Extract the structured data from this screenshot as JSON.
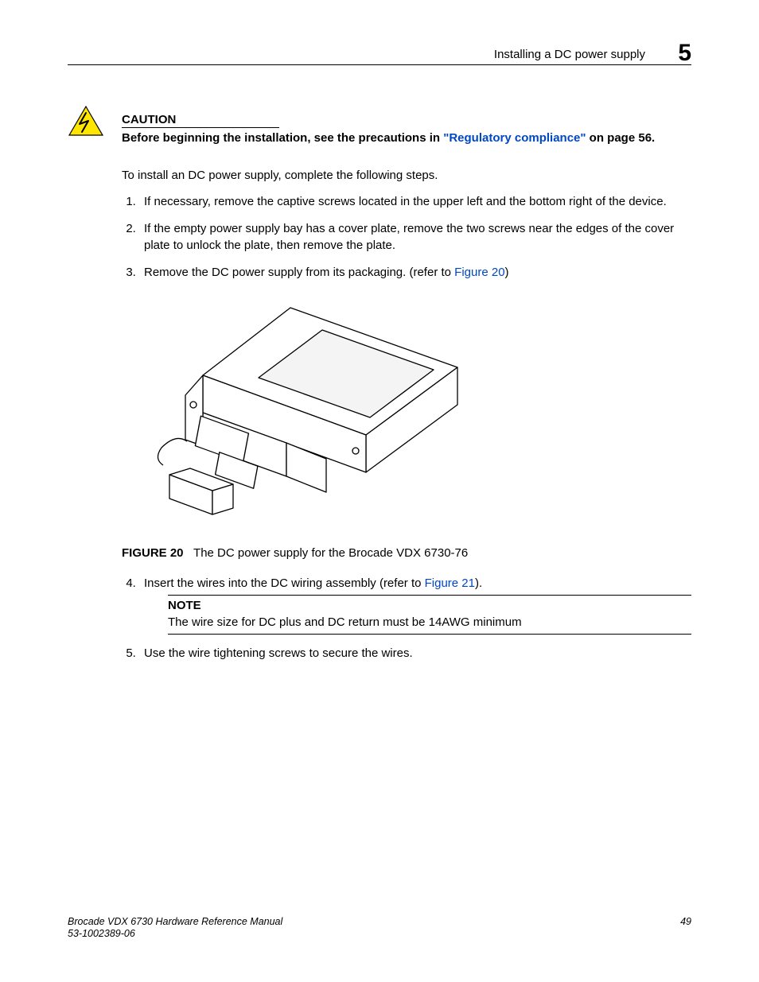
{
  "header": {
    "section_title": "Installing a DC power supply",
    "chapter_number": "5"
  },
  "caution": {
    "label": "CAUTION",
    "text_before_link": "Before beginning the installation, see the precautions in ",
    "link_text": "\"Regulatory compliance\"",
    "text_after_link": " on page 56."
  },
  "intro": "To install an DC power supply, complete the following steps.",
  "steps": {
    "s1": "If necessary, remove the captive screws located in the upper left and the bottom right of the device.",
    "s2": "If the empty power supply bay has a cover plate, remove the two screws near the edges of the cover plate to unlock the plate, then remove the plate.",
    "s3_before": "Remove the DC power supply from its packaging. (refer to ",
    "s3_link": "Figure 20",
    "s3_after": ")",
    "s4_before": "Insert the wires into the DC wiring assembly (refer to ",
    "s4_link": "Figure 21",
    "s4_after": ").",
    "s5": "Use the wire tightening screws to secure the wires."
  },
  "figure": {
    "label": "FIGURE 20",
    "caption": "The DC power supply for the Brocade VDX 6730-76"
  },
  "note": {
    "label": "NOTE",
    "text": "The wire size for DC plus and DC return must be 14AWG minimum"
  },
  "footer": {
    "doc_title": "Brocade VDX 6730 Hardware Reference Manual",
    "doc_number": "53-1002389-06",
    "page": "49"
  }
}
